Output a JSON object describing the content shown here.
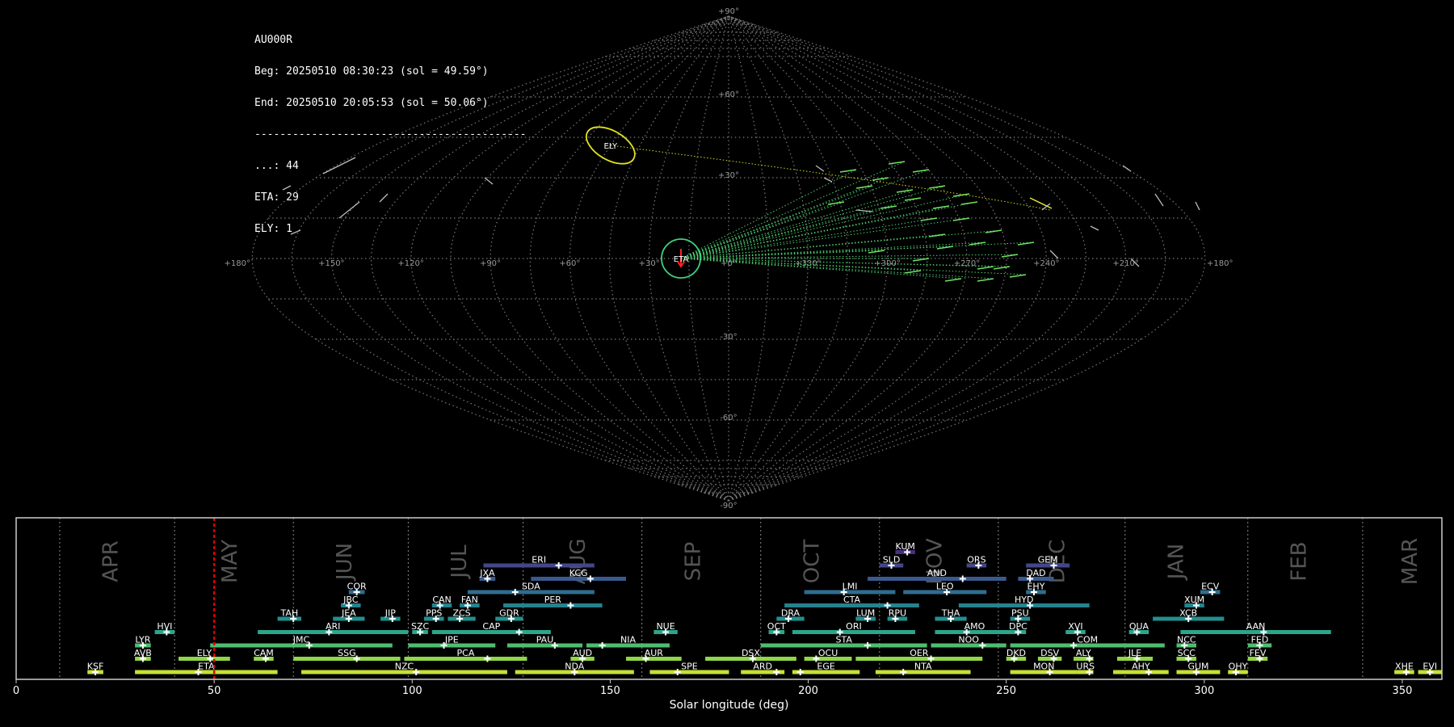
{
  "header": {
    "station": "AU000R",
    "begin": "Beg: 20250510 08:30:23 (sol = 49.59°)",
    "end": "End: 20250510 20:05:53 (sol = 50.06°)",
    "separator": "-------------------------------------------",
    "counts": [
      "...: 44",
      "ETA: 29",
      "ELY: 1"
    ]
  },
  "chart_data": [
    {
      "type": "scatter",
      "projection": "sinusoidal",
      "lon_labels": [
        "+180°",
        "+150°",
        "+120°",
        "+90°",
        "+60°",
        "+30°",
        "+0°",
        "+330°",
        "+300°",
        "+270°",
        "+240°",
        "+210°",
        "+180°"
      ],
      "lat_labels": [
        "+90°",
        "+60°",
        "+30°",
        "-30°",
        "-60°",
        "-90°"
      ],
      "radiants": [
        {
          "name": "ETA",
          "lon": -18,
          "lat": 0,
          "color": "#40d080"
        },
        {
          "name": "ELY",
          "lon": -60,
          "lat": 42,
          "color": "#e0e020"
        }
      ]
    },
    {
      "type": "timeline",
      "xlabel": "Solar longitude (deg)",
      "xlim": [
        0,
        360
      ],
      "xticks": [
        "0",
        "50",
        "100",
        "150",
        "200",
        "250",
        "300",
        "350"
      ],
      "current_sol": 50,
      "months": [
        {
          "label": "APR",
          "x": 24
        },
        {
          "label": "MAY",
          "x": 54
        },
        {
          "label": "JUN",
          "x": 83
        },
        {
          "label": "JUL",
          "x": 112
        },
        {
          "label": "AUG",
          "x": 142
        },
        {
          "label": "SEP",
          "x": 171
        },
        {
          "label": "OCT",
          "x": 201
        },
        {
          "label": "NOV",
          "x": 232
        },
        {
          "label": "DEC",
          "x": 263
        },
        {
          "label": "JAN",
          "x": 293
        },
        {
          "label": "FEB",
          "x": 324
        },
        {
          "label": "MAR",
          "x": 352
        }
      ],
      "month_boundaries": [
        11,
        40,
        70,
        99,
        128,
        158,
        188,
        218,
        248,
        280,
        311,
        340
      ],
      "showers": [
        {
          "name": "KSF",
          "start": 18,
          "end": 22,
          "peak": 20,
          "row": 0
        },
        {
          "name": "ETA",
          "start": 30,
          "end": 66,
          "peak": 46,
          "row": 0
        },
        {
          "name": "NZC",
          "start": 72,
          "end": 124,
          "peak": 101,
          "row": 0
        },
        {
          "name": "NDA",
          "start": 126,
          "end": 156,
          "peak": 141,
          "row": 0
        },
        {
          "name": "SPE",
          "start": 160,
          "end": 180,
          "peak": 167,
          "row": 0
        },
        {
          "name": "ARD",
          "start": 183,
          "end": 194,
          "peak": 192,
          "row": 0
        },
        {
          "name": "EGE",
          "start": 196,
          "end": 213,
          "peak": 198,
          "row": 0
        },
        {
          "name": "NTA",
          "start": 217,
          "end": 241,
          "peak": 224,
          "row": 0
        },
        {
          "name": "MON",
          "start": 251,
          "end": 268,
          "peak": 261,
          "row": 0
        },
        {
          "name": "URS",
          "start": 268,
          "end": 272,
          "peak": 271,
          "row": 0
        },
        {
          "name": "AHY",
          "start": 277,
          "end": 291,
          "peak": 286,
          "row": 0
        },
        {
          "name": "GUM",
          "start": 293,
          "end": 304,
          "peak": 298,
          "row": 0
        },
        {
          "name": "OHY",
          "start": 306,
          "end": 311,
          "peak": 308,
          "row": 0
        },
        {
          "name": "XHE",
          "start": 348,
          "end": 353,
          "peak": 351,
          "row": 0
        },
        {
          "name": "EVI",
          "start": 354,
          "end": 360,
          "peak": 357,
          "row": 0
        },
        {
          "name": "AVB",
          "start": 30,
          "end": 34,
          "peak": 32,
          "row": 1
        },
        {
          "name": "ELY",
          "start": 41,
          "end": 54,
          "peak": 49,
          "row": 1
        },
        {
          "name": "CAM",
          "start": 60,
          "end": 65,
          "peak": 63,
          "row": 1
        },
        {
          "name": "SSG",
          "start": 70,
          "end": 97,
          "peak": 86,
          "row": 1
        },
        {
          "name": "PCA",
          "start": 98,
          "end": 129,
          "peak": 119,
          "row": 1
        },
        {
          "name": "AUD",
          "start": 140,
          "end": 146,
          "peak": 143,
          "row": 1
        },
        {
          "name": "AUR",
          "start": 154,
          "end": 168,
          "peak": 159,
          "row": 1
        },
        {
          "name": "DSX",
          "start": 174,
          "end": 197,
          "peak": 186,
          "row": 1
        },
        {
          "name": "OCU",
          "start": 199,
          "end": 211,
          "peak": 202,
          "row": 1
        },
        {
          "name": "OER",
          "start": 212,
          "end": 244,
          "peak": 231,
          "row": 1
        },
        {
          "name": "DKD",
          "start": 250,
          "end": 255,
          "peak": 252,
          "row": 1
        },
        {
          "name": "DSV",
          "start": 258,
          "end": 264,
          "peak": 262,
          "row": 1
        },
        {
          "name": "ALY",
          "start": 267,
          "end": 272,
          "peak": 271,
          "row": 1
        },
        {
          "name": "JLE",
          "start": 278,
          "end": 287,
          "peak": 283,
          "row": 1
        },
        {
          "name": "SCC",
          "start": 293,
          "end": 298,
          "peak": 296,
          "row": 1
        },
        {
          "name": "FEV",
          "start": 311,
          "end": 316,
          "peak": 314,
          "row": 1
        },
        {
          "name": "LYR",
          "start": 30,
          "end": 34,
          "peak": 32,
          "row": 2
        },
        {
          "name": "JMC",
          "start": 49,
          "end": 95,
          "peak": 74,
          "row": 2
        },
        {
          "name": "JPE",
          "start": 99,
          "end": 121,
          "peak": 108,
          "row": 2
        },
        {
          "name": "PAU",
          "start": 124,
          "end": 143,
          "peak": 136,
          "row": 2
        },
        {
          "name": "NIA",
          "start": 144,
          "end": 165,
          "peak": 148,
          "row": 2
        },
        {
          "name": "STA",
          "start": 188,
          "end": 230,
          "peak": 215,
          "row": 2
        },
        {
          "name": "NOO",
          "start": 231,
          "end": 250,
          "peak": 244,
          "row": 2
        },
        {
          "name": "COM",
          "start": 251,
          "end": 290,
          "peak": 267,
          "row": 2
        },
        {
          "name": "NCC",
          "start": 293,
          "end": 298,
          "peak": 295,
          "row": 2
        },
        {
          "name": "FED",
          "start": 311,
          "end": 317,
          "peak": 314,
          "row": 2
        },
        {
          "name": "HVI",
          "start": 35,
          "end": 40,
          "peak": 38,
          "row": 3
        },
        {
          "name": "ARI",
          "start": 61,
          "end": 99,
          "peak": 79,
          "row": 3
        },
        {
          "name": "SZC",
          "start": 100,
          "end": 104,
          "peak": 102,
          "row": 3
        },
        {
          "name": "CAP",
          "start": 105,
          "end": 135,
          "peak": 127,
          "row": 3
        },
        {
          "name": "NUE",
          "start": 161,
          "end": 167,
          "peak": 164,
          "row": 3
        },
        {
          "name": "OCT",
          "start": 190,
          "end": 194,
          "peak": 192,
          "row": 3
        },
        {
          "name": "ORI",
          "start": 196,
          "end": 227,
          "peak": 208,
          "row": 3
        },
        {
          "name": "AMO",
          "start": 232,
          "end": 252,
          "peak": 240,
          "row": 3
        },
        {
          "name": "DPC",
          "start": 251,
          "end": 255,
          "peak": 253,
          "row": 3
        },
        {
          "name": "XVI",
          "start": 265,
          "end": 270,
          "peak": 268,
          "row": 3
        },
        {
          "name": "QUA",
          "start": 281,
          "end": 286,
          "peak": 283,
          "row": 3
        },
        {
          "name": "AAN",
          "start": 294,
          "end": 332,
          "peak": 315,
          "row": 3
        },
        {
          "name": "TAH",
          "start": 66,
          "end": 72,
          "peak": 70,
          "row": 4
        },
        {
          "name": "JEA",
          "start": 80,
          "end": 88,
          "peak": 84,
          "row": 4
        },
        {
          "name": "JIP",
          "start": 92,
          "end": 97,
          "peak": 95,
          "row": 4
        },
        {
          "name": "PPS",
          "start": 103,
          "end": 108,
          "peak": 106,
          "row": 4
        },
        {
          "name": "ZCS",
          "start": 109,
          "end": 116,
          "peak": 112,
          "row": 4
        },
        {
          "name": "GDR",
          "start": 121,
          "end": 128,
          "peak": 125,
          "row": 4
        },
        {
          "name": "DRA",
          "start": 192,
          "end": 199,
          "peak": 195,
          "row": 4
        },
        {
          "name": "LUM",
          "start": 212,
          "end": 217,
          "peak": 215,
          "row": 4
        },
        {
          "name": "RPU",
          "start": 220,
          "end": 225,
          "peak": 222,
          "row": 4
        },
        {
          "name": "THA",
          "start": 232,
          "end": 240,
          "peak": 236,
          "row": 4
        },
        {
          "name": "PSU",
          "start": 251,
          "end": 256,
          "peak": 253,
          "row": 4
        },
        {
          "name": "XCB",
          "start": 287,
          "end": 305,
          "peak": 296,
          "row": 4
        },
        {
          "name": "JBC",
          "start": 82,
          "end": 87,
          "peak": 84,
          "row": 5
        },
        {
          "name": "CAN",
          "start": 105,
          "end": 110,
          "peak": 107,
          "row": 5
        },
        {
          "name": "FAN",
          "start": 112,
          "end": 117,
          "peak": 114,
          "row": 5
        },
        {
          "name": "PER",
          "start": 123,
          "end": 148,
          "peak": 140,
          "row": 5
        },
        {
          "name": "CTA",
          "start": 194,
          "end": 228,
          "peak": 220,
          "row": 5
        },
        {
          "name": "HYD",
          "start": 238,
          "end": 271,
          "peak": 256,
          "row": 5
        },
        {
          "name": "XUM",
          "start": 295,
          "end": 300,
          "peak": 298,
          "row": 5
        },
        {
          "name": "COR",
          "start": 84,
          "end": 88,
          "peak": 86,
          "row": 6
        },
        {
          "name": "SDA",
          "start": 114,
          "end": 146,
          "peak": 126,
          "row": 6
        },
        {
          "name": "LMI",
          "start": 199,
          "end": 222,
          "peak": 209,
          "row": 6
        },
        {
          "name": "LEO",
          "start": 224,
          "end": 245,
          "peak": 235,
          "row": 6
        },
        {
          "name": "EHY",
          "start": 255,
          "end": 260,
          "peak": 257,
          "row": 6
        },
        {
          "name": "ECV",
          "start": 299,
          "end": 304,
          "peak": 302,
          "row": 6
        },
        {
          "name": "JXA",
          "start": 117,
          "end": 121,
          "peak": 119,
          "row": 7
        },
        {
          "name": "KCG",
          "start": 130,
          "end": 154,
          "peak": 145,
          "row": 7
        },
        {
          "name": "AND",
          "start": 215,
          "end": 250,
          "peak": 239,
          "row": 7
        },
        {
          "name": "DAD",
          "start": 253,
          "end": 262,
          "peak": 256,
          "row": 7
        },
        {
          "name": "ERI",
          "start": 118,
          "end": 146,
          "peak": 137,
          "row": 8
        },
        {
          "name": "SLD",
          "start": 218,
          "end": 224,
          "peak": 221,
          "row": 8
        },
        {
          "name": "ORS",
          "start": 240,
          "end": 245,
          "peak": 243,
          "row": 8
        },
        {
          "name": "GEM",
          "start": 255,
          "end": 266,
          "peak": 262,
          "row": 8
        },
        {
          "name": "KUM",
          "start": 222,
          "end": 227,
          "peak": 225,
          "row": 9
        }
      ]
    }
  ]
}
